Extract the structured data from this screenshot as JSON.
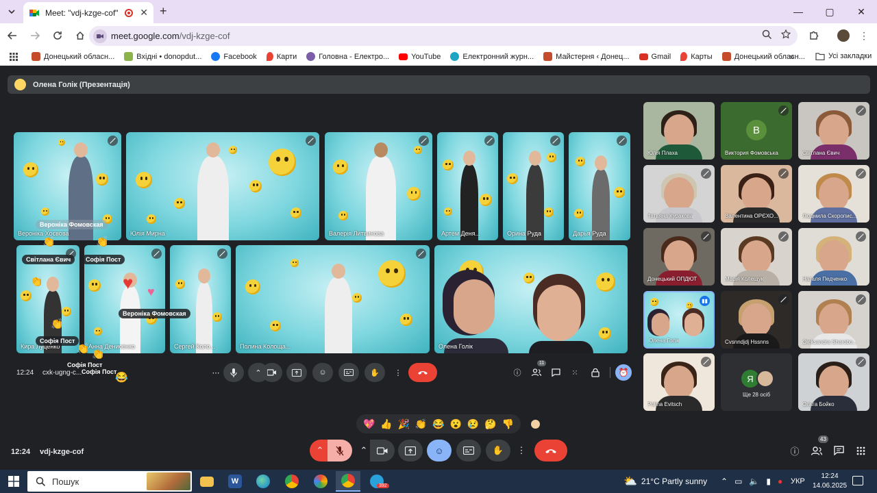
{
  "browser": {
    "tab_title": "Meet: \"vdj-kzge-cof\"",
    "url_host": "meet.google.com",
    "url_path": "/vdj-kzge-cof"
  },
  "bookmarks": {
    "items": [
      {
        "label": "Донецький обласн...",
        "color": "#c44b2b"
      },
      {
        "label": "Вхідні • donopdut...",
        "color": "#8bb34a"
      },
      {
        "label": "Facebook",
        "color": "#1877f2"
      },
      {
        "label": "Карти",
        "color": "#ea4335"
      },
      {
        "label": "Головна - Електро...",
        "color": "#7b5ea7"
      },
      {
        "label": "YouTube",
        "color": "#ff0000"
      },
      {
        "label": "Електронний журн...",
        "color": "#1ea5c4"
      },
      {
        "label": "Майстерня ‹ Донец...",
        "color": "#c44b2b"
      },
      {
        "label": "Gmail",
        "color": "#d93025"
      },
      {
        "label": "Карты",
        "color": "#ea4335"
      },
      {
        "label": "Донецький обласн...",
        "color": "#c44b2b"
      }
    ],
    "more": "»",
    "all_label": "Усі закладки"
  },
  "meet": {
    "presenter_banner": "Олена Голік (Презентація)",
    "presentation_tiles": [
      {
        "name": "Вероніка Хоєвова"
      },
      {
        "name": "Юлія Мирна"
      },
      {
        "name": "Валерія Литвинова"
      },
      {
        "name": "Артем Деня..."
      },
      {
        "name": "Орина Руда"
      },
      {
        "name": "Дарья Руда"
      },
      {
        "name": "Кира Луценко"
      },
      {
        "name": "Анна Денисенко"
      },
      {
        "name": "Сергей Коло..."
      },
      {
        "name": "Полина Колоща..."
      },
      {
        "name": "Олена Голік"
      }
    ],
    "floating_names": {
      "n1": "Вероніка Фомовская",
      "n2": "Світлана Євич",
      "n3": "Софія Пост",
      "n4": "Вероніка Фомовская",
      "n5": "Софія Пост",
      "n6": "Софія Пост",
      "n7": "Софія Пост"
    },
    "grid": [
      {
        "name": "Юлія Плаха"
      },
      {
        "name": "Виктория Фомовська",
        "initial": "В"
      },
      {
        "name": "Світлана Євич"
      },
      {
        "name": "Татьяна Куракова"
      },
      {
        "name": "Валентина ОРЄХО..."
      },
      {
        "name": "Людмила Скоропис..."
      },
      {
        "name": "Донецький ОПДЮТ"
      },
      {
        "name": "Марія Колещук"
      },
      {
        "name": "Наталя Педченко"
      },
      {
        "name": "Олена Голік"
      },
      {
        "name": "Cvsnndjdj Hssnns"
      },
      {
        "name": "Oleksandra Sharobo..."
      },
      {
        "name": "Polina Evitsch"
      },
      {
        "name": "Ще 28 осіб",
        "initial": "Я"
      },
      {
        "name": "Ольга Бойко"
      }
    ],
    "inner_bar": {
      "time": "12:24",
      "code": "cxk-ugng-c...",
      "people_badge": "11"
    },
    "reactions": [
      "💖",
      "👍",
      "🎉",
      "👏",
      "😂",
      "😮",
      "😢",
      "🤔",
      "👎"
    ],
    "bottom_bar": {
      "time": "12:24",
      "code": "vdj-kzge-cof",
      "people_badge": "43"
    }
  },
  "taskbar": {
    "search_placeholder": "Пошук",
    "telegram_badge": "392",
    "weather": "21°C  Partly sunny",
    "lang": "УКР",
    "time": "12:24",
    "date": "14.06.2025"
  }
}
